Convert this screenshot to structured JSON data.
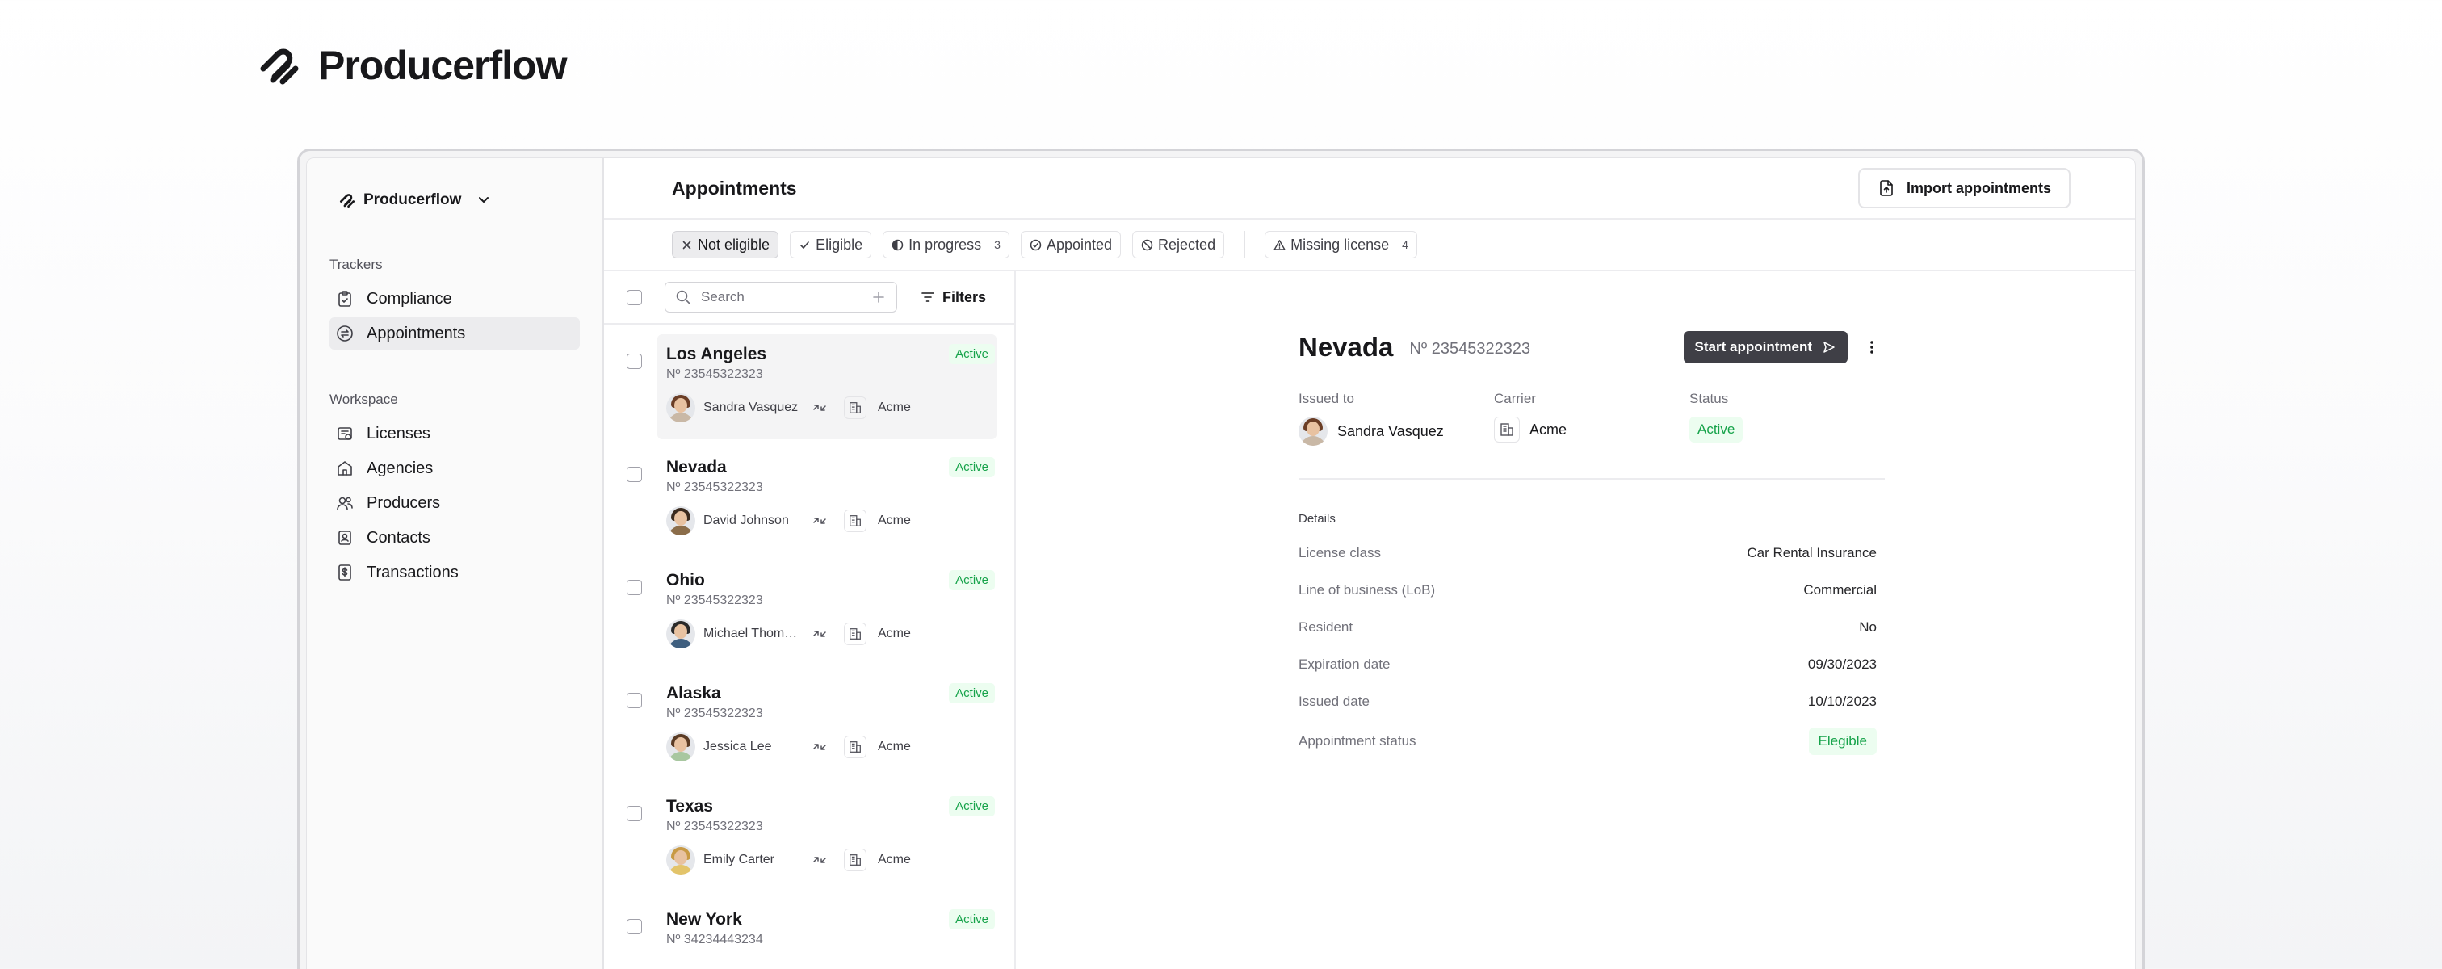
{
  "hero": {
    "brand": "Producerflow"
  },
  "sidebar": {
    "workspace_name": "Producerflow",
    "trackers_label": "Trackers",
    "trackers": [
      {
        "label": "Compliance",
        "icon": "clipboard-check-icon",
        "active": false
      },
      {
        "label": "Appointments",
        "icon": "arrows-cycle-icon",
        "active": true
      }
    ],
    "workspace_label": "Workspace",
    "workspace_items": [
      {
        "label": "Licenses",
        "icon": "license-icon"
      },
      {
        "label": "Agencies",
        "icon": "agency-icon"
      },
      {
        "label": "Producers",
        "icon": "users-icon"
      },
      {
        "label": "Contacts",
        "icon": "contacts-icon"
      },
      {
        "label": "Transactions",
        "icon": "dollar-doc-icon"
      }
    ]
  },
  "header": {
    "title": "Appointments",
    "import_label": "Import appointments"
  },
  "filters": {
    "chips": [
      {
        "label": "Not eligible",
        "icon": "x-icon",
        "selected": true
      },
      {
        "label": "Eligible",
        "icon": "check-icon"
      },
      {
        "label": "In progress",
        "icon": "half-circle-icon",
        "count": "3"
      },
      {
        "label": "Appointed",
        "icon": "check-circle-icon"
      },
      {
        "label": "Rejected",
        "icon": "ban-icon"
      }
    ],
    "extra_chip": {
      "label": "Missing license",
      "icon": "warning-icon",
      "count": "4"
    }
  },
  "list": {
    "search_placeholder": "Search",
    "filters_label": "Filters",
    "rows": [
      {
        "title": "Los Angeles",
        "number": "Nº 23545322323",
        "status": "Active",
        "person": "Sandra Vasquez",
        "carrier": "Acme",
        "selected": true,
        "hair": "#6b3e26",
        "shirt": "#c9b8a6"
      },
      {
        "title": "Nevada",
        "number": "Nº 23545322323",
        "status": "Active",
        "person": "David Johnson",
        "carrier": "Acme",
        "hair": "#3a2a1e",
        "shirt": "#8b6d4a"
      },
      {
        "title": "Ohio",
        "number": "Nº 23545322323",
        "status": "Active",
        "person": "Michael Thompson",
        "carrier": "Acme",
        "hair": "#2a2a2a",
        "shirt": "#3f5f7f"
      },
      {
        "title": "Alaska",
        "number": "Nº 23545322323",
        "status": "Active",
        "person": "Jessica Lee",
        "carrier": "Acme",
        "hair": "#5a3b24",
        "shirt": "#a8c7a0"
      },
      {
        "title": "Texas",
        "number": "Nº 23545322323",
        "status": "Active",
        "person": "Emily Carter",
        "carrier": "Acme",
        "hair": "#c89a45",
        "shirt": "#e3c46a"
      },
      {
        "title": "New York",
        "number": "Nº 34234443234",
        "status": "Active",
        "person": "",
        "carrier": "",
        "hair": "#4a3a2a",
        "shirt": "#7a7a7a"
      }
    ]
  },
  "detail": {
    "title": "Nevada",
    "number": "Nº 23545322323",
    "start_label": "Start appointment",
    "issued_to_label": "Issued to",
    "issued_to": "Sandra Vasquez",
    "carrier_label": "Carrier",
    "carrier": "Acme",
    "status_label": "Status",
    "status": "Active",
    "details_label": "Details",
    "fields": [
      {
        "key": "License class",
        "value": "Car Rental Insurance"
      },
      {
        "key": "Line of business (LoB)",
        "value": "Commercial"
      },
      {
        "key": "Resident",
        "value": "No"
      },
      {
        "key": "Expiration date",
        "value": "09/30/2023"
      },
      {
        "key": "Issued date",
        "value": "10/10/2023"
      }
    ],
    "appointment_status_label": "Appointment status",
    "appointment_status": "Elegible"
  },
  "colors": {
    "active_green": "#16a34a",
    "active_bg": "#ecfdf0",
    "primary_button": "#3f3f46"
  }
}
